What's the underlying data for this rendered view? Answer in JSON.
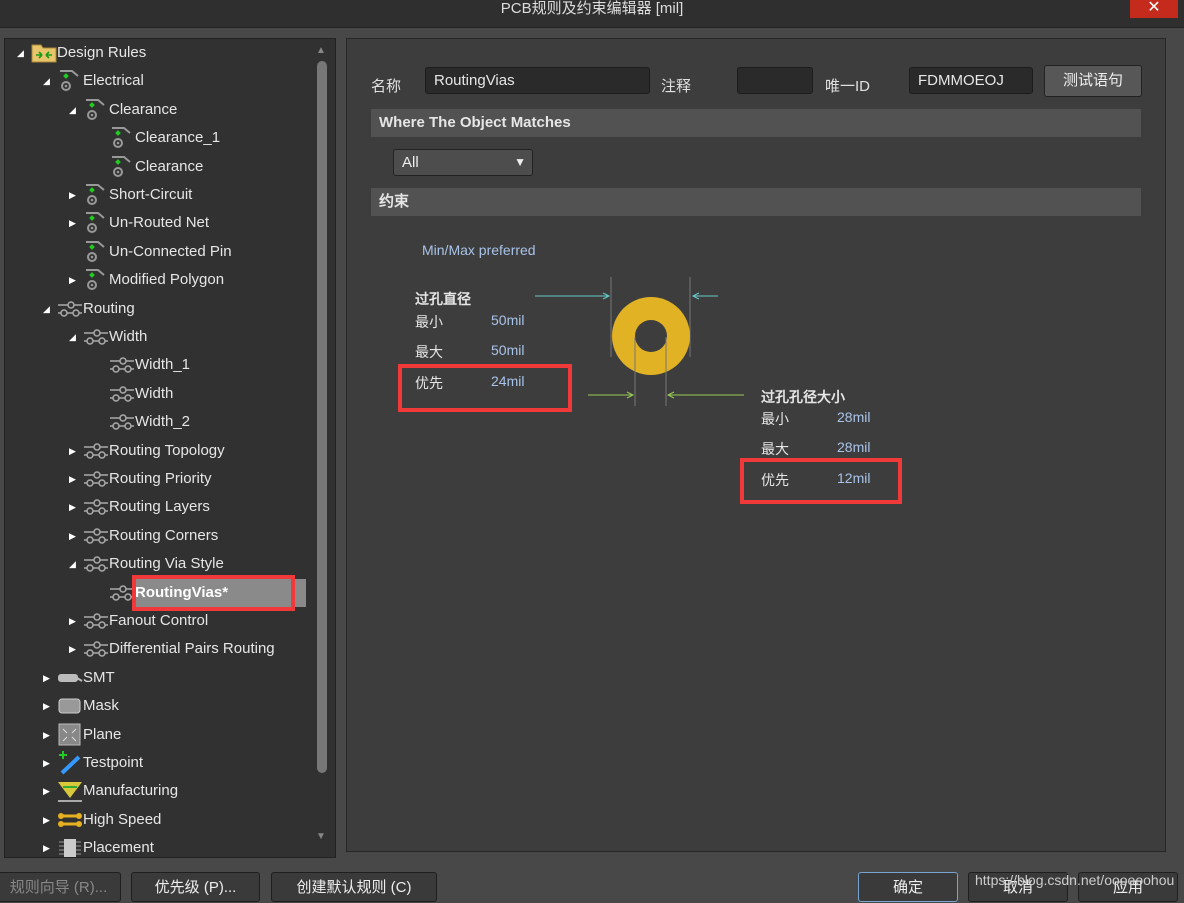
{
  "window": {
    "title": "PCB规则及约束编辑器 [mil]",
    "close": "✕"
  },
  "tree": [
    {
      "label": "Design Rules",
      "level": 0,
      "state": "open",
      "icon": "folder-icon"
    },
    {
      "label": "Electrical",
      "level": 1,
      "state": "open",
      "icon": "electrical-rule-icon"
    },
    {
      "label": "Clearance",
      "level": 2,
      "state": "open",
      "icon": "electrical-rule-icon"
    },
    {
      "label": "Clearance_1",
      "level": 3,
      "state": "none",
      "icon": "electrical-rule-icon"
    },
    {
      "label": "Clearance",
      "level": 3,
      "state": "none",
      "icon": "electrical-rule-icon"
    },
    {
      "label": "Short-Circuit",
      "level": 2,
      "state": "closed",
      "icon": "electrical-rule-icon"
    },
    {
      "label": "Un-Routed Net",
      "level": 2,
      "state": "closed",
      "icon": "electrical-rule-icon"
    },
    {
      "label": "Un-Connected Pin",
      "level": 2,
      "state": "none",
      "icon": "electrical-rule-icon"
    },
    {
      "label": "Modified Polygon",
      "level": 2,
      "state": "closed",
      "icon": "electrical-rule-icon"
    },
    {
      "label": "Routing",
      "level": 1,
      "state": "open",
      "icon": "routing-rule-icon"
    },
    {
      "label": "Width",
      "level": 2,
      "state": "open",
      "icon": "routing-rule-icon"
    },
    {
      "label": "Width_1",
      "level": 3,
      "state": "none",
      "icon": "routing-rule-icon"
    },
    {
      "label": "Width",
      "level": 3,
      "state": "none",
      "icon": "routing-rule-icon"
    },
    {
      "label": "Width_2",
      "level": 3,
      "state": "none",
      "icon": "routing-rule-icon"
    },
    {
      "label": "Routing Topology",
      "level": 2,
      "state": "closed",
      "icon": "routing-rule-icon"
    },
    {
      "label": "Routing Priority",
      "level": 2,
      "state": "closed",
      "icon": "routing-rule-icon"
    },
    {
      "label": "Routing Layers",
      "level": 2,
      "state": "closed",
      "icon": "routing-rule-icon"
    },
    {
      "label": "Routing Corners",
      "level": 2,
      "state": "closed",
      "icon": "routing-rule-icon"
    },
    {
      "label": "Routing Via Style",
      "level": 2,
      "state": "open",
      "icon": "routing-rule-icon"
    },
    {
      "label": "RoutingVias*",
      "level": 3,
      "state": "none",
      "icon": "routing-rule-icon",
      "selected": true
    },
    {
      "label": "Fanout Control",
      "level": 2,
      "state": "closed",
      "icon": "routing-rule-icon"
    },
    {
      "label": "Differential Pairs Routing",
      "level": 2,
      "state": "closed",
      "icon": "routing-rule-icon"
    },
    {
      "label": "SMT",
      "level": 1,
      "state": "closed",
      "icon": "smt-icon"
    },
    {
      "label": "Mask",
      "level": 1,
      "state": "closed",
      "icon": "mask-icon"
    },
    {
      "label": "Plane",
      "level": 1,
      "state": "closed",
      "icon": "plane-icon"
    },
    {
      "label": "Testpoint",
      "level": 1,
      "state": "closed",
      "icon": "testpoint-icon"
    },
    {
      "label": "Manufacturing",
      "level": 1,
      "state": "closed",
      "icon": "manufacturing-icon"
    },
    {
      "label": "High Speed",
      "level": 1,
      "state": "closed",
      "icon": "high-speed-icon"
    },
    {
      "label": "Placement",
      "level": 1,
      "state": "closed",
      "icon": "placement-icon"
    }
  ],
  "form": {
    "name_label": "名称",
    "name_value": "RoutingVias",
    "comment_label": "注释",
    "comment_value": "",
    "id_label": "唯一ID",
    "id_value": "FDMMOEOJ",
    "test_button": "测试语句"
  },
  "match": {
    "header": "Where The Object Matches",
    "selected": "All"
  },
  "constraints": {
    "header": "约束",
    "mode": "Min/Max preferred",
    "via_diameter": {
      "title": "过孔直径",
      "min_label": "最小",
      "min": "50mil",
      "max_label": "最大",
      "max": "50mil",
      "pref_label": "优先",
      "pref": "24mil"
    },
    "hole_size": {
      "title": "过孔孔径大小",
      "min_label": "最小",
      "min": "28mil",
      "max_label": "最大",
      "max": "28mil",
      "pref_label": "优先",
      "pref": "12mil"
    },
    "via_color": "#e1b224"
  },
  "footer": {
    "wizard": "规则向导 (R)...",
    "priority": "优先级 (P)...",
    "create_default": "创建默认规则 (C)",
    "ok": "确定",
    "cancel": "取消",
    "apply": "应用",
    "watermark": "https://blog.csdn.net/oooooohou"
  }
}
